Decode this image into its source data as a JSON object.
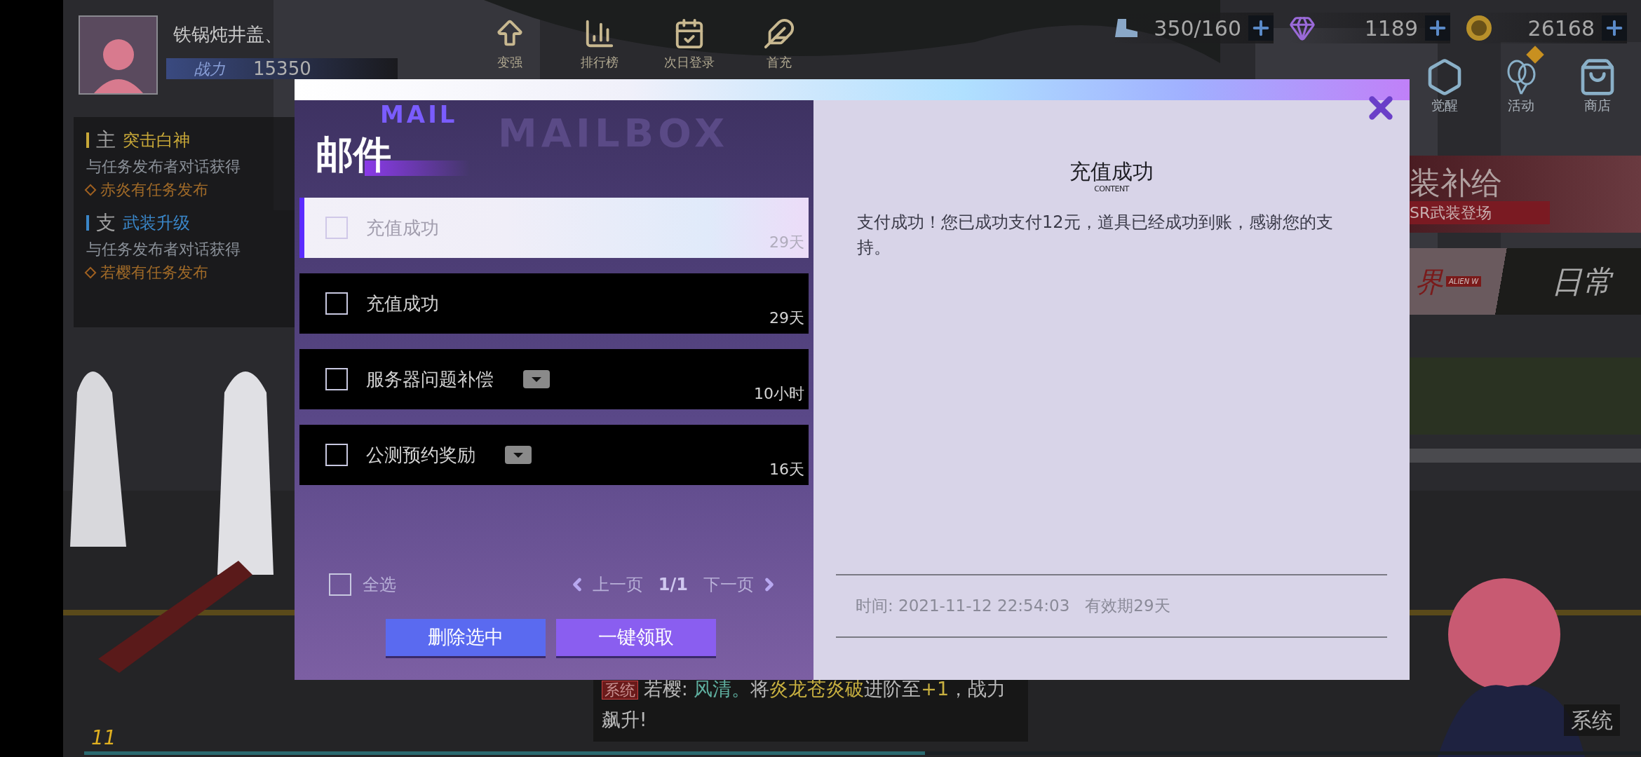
{
  "hud": {
    "player_name": "铁锅炖井盖、",
    "power_label": "战力",
    "power": "15350",
    "menu": [
      {
        "label": "变强",
        "kind": "up"
      },
      {
        "label": "排行榜",
        "kind": "rank"
      },
      {
        "label": "次日登录",
        "kind": "calendar"
      },
      {
        "label": "首充",
        "kind": "feather"
      }
    ],
    "resources": [
      {
        "value": "350/160",
        "kind": "stamina"
      },
      {
        "value": "1189",
        "kind": "crystal"
      },
      {
        "value": "26168",
        "kind": "coin"
      }
    ],
    "side_menu": [
      {
        "label": "觉醒",
        "kind": "awaken",
        "alert": false
      },
      {
        "label": "活动",
        "kind": "event",
        "alert": true
      },
      {
        "label": "商店",
        "kind": "shop",
        "alert": false
      }
    ]
  },
  "banners": [
    {
      "title": "装补给",
      "subtitle": "SR武装登场",
      "kind": "supply"
    },
    {
      "title": "界",
      "subtitle": "ALIEN W",
      "extra": "日常",
      "kind": "daily"
    }
  ],
  "quests": [
    {
      "tag": "主",
      "title": "突击白神",
      "description": "与任务发布者对话获得",
      "note": "赤炎有任务发布",
      "color": "#c8a838"
    },
    {
      "tag": "支",
      "title": "武装升级",
      "description": "与任务发布者对话获得",
      "note": "若樱有任务发布",
      "color": "#3a86c8"
    }
  ],
  "chat": {
    "tag": "系统",
    "parts": [
      {
        "text": "若樱: ",
        "color": "#b8b8b8"
      },
      {
        "text": "风清。",
        "color": "#5fb0a0"
      },
      {
        "text": "将",
        "color": "#b8b8b8"
      },
      {
        "text": "炎龙苍炎破",
        "color": "#c8b040"
      },
      {
        "text": "进阶至",
        "color": "#b8b8b8"
      },
      {
        "text": "+1",
        "color": "#c8b040"
      },
      {
        "text": "，战力飙升!",
        "color": "#b8b8b8"
      }
    ]
  },
  "level": "11",
  "exp_bar": {
    "level": 0.54
  },
  "chat_button": "系统",
  "mail": {
    "backdrop": "MAILBOX",
    "subtitle": "MAIL",
    "title": "邮件",
    "items": [
      {
        "title": "充值成功",
        "expiry": "29天",
        "selected": true,
        "checked": false,
        "attachment": false
      },
      {
        "title": "充值成功",
        "expiry": "29天",
        "selected": false,
        "checked": false,
        "attachment": false
      },
      {
        "title": "服务器问题补偿",
        "expiry": "10小时",
        "selected": false,
        "checked": false,
        "attachment": true
      },
      {
        "title": "公测预约奖励",
        "expiry": "16天",
        "selected": false,
        "checked": false,
        "attachment": true
      }
    ],
    "select_all": {
      "label": "全选",
      "checked": false
    },
    "pager": {
      "previous": "上一页",
      "page": "1/1",
      "next": "下一页"
    },
    "buttons": [
      "删除选中",
      "一键领取"
    ]
  },
  "detail": {
    "title": "充值成功",
    "subtitle": "CONTENT",
    "body": "支付成功！您已成功支付12元，道具已经成功到账，感谢您的支持。",
    "time": "时间: 2021-11-12 22:54:03",
    "validity": "有效期29天"
  }
}
